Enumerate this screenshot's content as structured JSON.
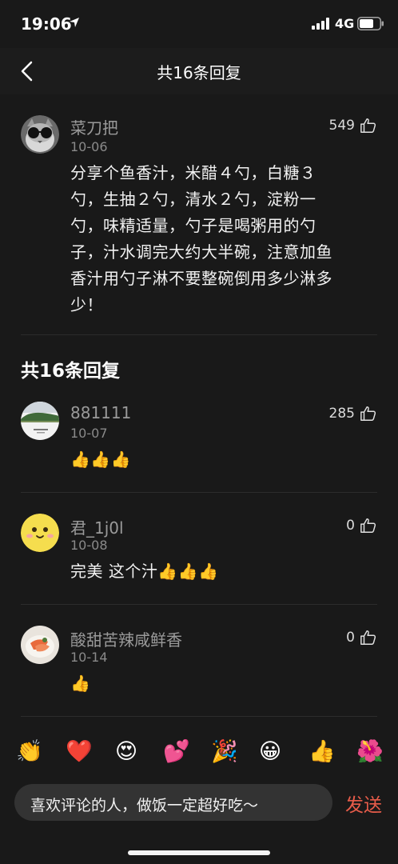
{
  "status_bar": {
    "time": "19:06",
    "network": "4G"
  },
  "nav": {
    "title": "共16条回复"
  },
  "main_comment": {
    "author": "菜刀把",
    "date": "10-06",
    "likes": "549",
    "text": "分享个鱼香汁，米醋４勺，白糖３勺，生抽２勺，清水２勺，淀粉一勺，味精适量，勺子是喝粥用的勺子，汁水调完大约大半碗，注意加鱼香汁用勺子淋不要整碗倒用多少淋多少！"
  },
  "replies_section": {
    "title": "共16条回复"
  },
  "replies": [
    {
      "author": "881111",
      "date": "10-07",
      "likes": "285",
      "text": "👍👍👍"
    },
    {
      "author": "君_1j0l",
      "date": "10-08",
      "likes": "0",
      "text": "完美 这个汁👍👍👍"
    },
    {
      "author": "酸甜苦辣咸鲜香",
      "date": "10-14",
      "likes": "0",
      "text": "👍"
    }
  ],
  "emoji_bar": {
    "items": [
      "👏",
      "❤️",
      "😍",
      "💕",
      "🎉",
      "😀",
      "👍",
      "🌺"
    ]
  },
  "input": {
    "placeholder": "喜欢评论的人，做饭一定超好吃～",
    "send_label": "发送"
  }
}
